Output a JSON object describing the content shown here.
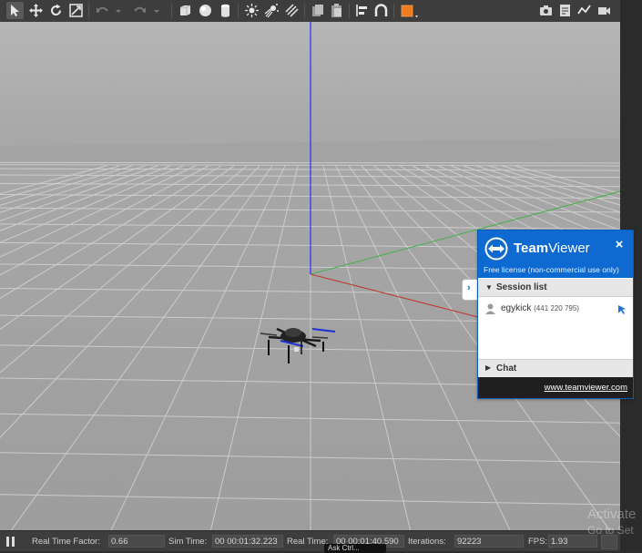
{
  "toolbar": {
    "icons": [
      "select-arrow-icon",
      "translate-icon",
      "rotate-icon",
      "scale-icon",
      "undo-icon",
      "dropdown-icon",
      "redo-icon",
      "dropdown-icon",
      "box-shape-icon",
      "sphere-shape-icon",
      "cylinder-shape-icon",
      "point-light-icon",
      "spot-light-icon",
      "directional-light-icon",
      "copy-icon",
      "paste-icon",
      "align-icon",
      "snap-icon",
      "color-palette-icon",
      "screenshot-icon",
      "log-icon",
      "plot-icon",
      "video-record-icon"
    ]
  },
  "teamviewer": {
    "brand_bold": "Team",
    "brand_light": "Viewer",
    "close_glyph": "×",
    "license": "Free license (non-commercial use only)",
    "session_list_label": "Session list",
    "contact": {
      "name": "egykick",
      "id": "(441 220 795)"
    },
    "chat_label": "Chat",
    "link": "www.teamviewer.com",
    "tab_glyph": "›",
    "colors": {
      "header": "#0e6ad0",
      "footer": "#1f1f1f"
    }
  },
  "statusbar": {
    "rtf_label": "Real Time Factor:",
    "rtf_value": "0.66",
    "sim_label": "Sim Time:",
    "sim_value": "00 00:01:32.223",
    "real_label": "Real Time:",
    "real_value": "00 00:01:40.590",
    "iter_label": "Iterations:",
    "iter_value": "92223",
    "fps_label": "FPS:",
    "fps_value": "1.93",
    "tooltip": "Ask Ctrl..."
  },
  "watermark": {
    "line1": "Activate",
    "line2": "Go to Set"
  }
}
